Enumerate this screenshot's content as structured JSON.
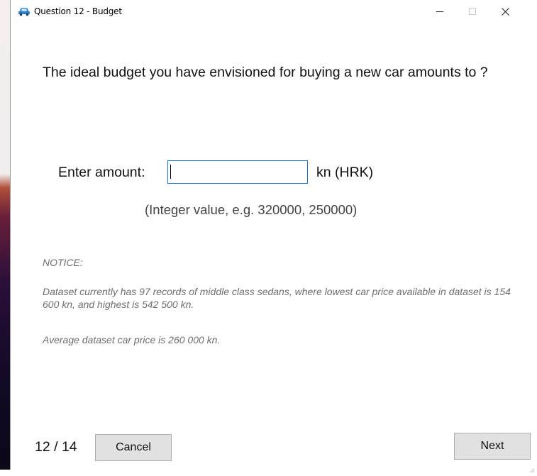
{
  "window": {
    "title": "Question 12 - Budget",
    "controls": {
      "minimize": "—",
      "maximize": "☐",
      "close": "✕"
    },
    "icon": "car-icon"
  },
  "question": {
    "text": "The ideal budget you have envisioned for buying a new car amounts to ?"
  },
  "amount": {
    "label": "Enter amount:",
    "value": "",
    "placeholder": "",
    "unit": "kn (HRK)",
    "hint": "(Integer value, e.g. 320000, 250000)"
  },
  "notice": {
    "title": "NOTICE:",
    "paragraph1": "Dataset currently has 97 records of middle class sedans, where lowest car price available in dataset is 154 600 kn, and highest is 542 500 kn.",
    "paragraph2": "Average dataset car price is 260 000 kn."
  },
  "footer": {
    "pager": "12 / 14",
    "cancel_label": "Cancel",
    "next_label": "Next"
  },
  "colors": {
    "input_border": "#1b73c9",
    "button_bg": "#e1e1e1",
    "notice_text": "#6e6e6e"
  }
}
